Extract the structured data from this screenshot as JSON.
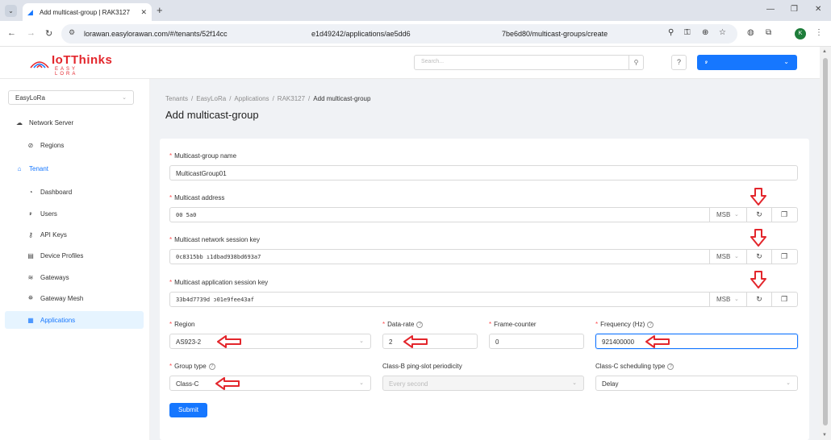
{
  "browser": {
    "tab_title": "Add multicast-group | RAK3127",
    "tab_close": "✕",
    "new_tab": "+",
    "url": "lorawan.easylorawan.com/#/tenants/52f14cc",
    "url_part2": "e1d49242/applications/ae5dd6",
    "url_part3": "7be6d80/multicast-groups/create",
    "profile_initial": "K"
  },
  "header": {
    "logo_text": "IoTThinks",
    "logo_sub": "EASY LORA",
    "search_placeholder": "Search...",
    "help": "?",
    "user_icon": "ꭾ"
  },
  "sidebar": {
    "tenant": "EasyLoRa",
    "network_server": "Network Server",
    "regions": "Regions",
    "tenant_label": "Tenant",
    "items": [
      {
        "label": "Dashboard",
        "icon": "dashboard-icon"
      },
      {
        "label": "Users",
        "icon": "user-icon"
      },
      {
        "label": "API Keys",
        "icon": "key-icon"
      },
      {
        "label": "Device Profiles",
        "icon": "profile-icon"
      },
      {
        "label": "Gateways",
        "icon": "wifi-icon"
      },
      {
        "label": "Gateway Mesh",
        "icon": "mesh-icon"
      },
      {
        "label": "Applications",
        "icon": "apps-icon"
      }
    ]
  },
  "breadcrumb": [
    "Tenants",
    "EasyLoRa",
    "Applications",
    "RAK3127",
    "Add multicast-group"
  ],
  "page_title": "Add multicast-group",
  "form": {
    "name_label": "Multicast-group name",
    "name_value": "MulticastGroup01",
    "addr_label": "Multicast address",
    "addr_value": "00     5a0",
    "nwk_label": "Multicast network session key",
    "nwk_value": "0c8315bb          ı1dbad938bd693a7",
    "app_label": "Multicast application session key",
    "app_value": "33b4d7739d           ɔ01e9fee43af",
    "msb": "MSB",
    "region_label": "Region",
    "region_value": "AS923-2",
    "dr_label": "Data-rate",
    "dr_value": "2",
    "fc_label": "Frame-counter",
    "fc_value": "0",
    "freq_label": "Frequency (Hz)",
    "freq_value": "921400000",
    "group_label": "Group type",
    "group_value": "Class-C",
    "ping_label": "Class-B ping-slot periodicity",
    "ping_placeholder": "Every second",
    "sched_label": "Class-C scheduling type",
    "sched_value": "Delay",
    "submit": "Submit"
  },
  "colors": {
    "primary": "#1677ff",
    "required": "#ff4d4f",
    "annotation": "#e3262c"
  }
}
